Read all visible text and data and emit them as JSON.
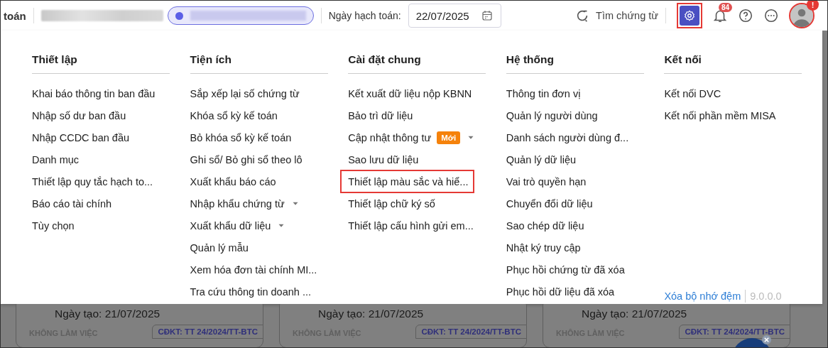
{
  "header": {
    "title": "toán",
    "date_label": "Ngày hạch toán:",
    "date_value": "22/07/2025",
    "search_label": "Tìm chứng từ",
    "settings_highlighted": true,
    "notification_count": "84",
    "avatar_alert": "!"
  },
  "menu": {
    "columns": [
      {
        "title": "Thiết lập",
        "items": [
          {
            "label": "Khai báo thông tin ban đầu"
          },
          {
            "label": "Nhập số dư ban đầu"
          },
          {
            "label": "Nhập CCDC ban đầu"
          },
          {
            "label": "Danh mục"
          },
          {
            "label": "Thiết lập quy tắc hạch to..."
          },
          {
            "label": "Báo cáo tài chính"
          },
          {
            "label": "Tùy chọn"
          }
        ]
      },
      {
        "title": "Tiện ích",
        "items": [
          {
            "label": "Sắp xếp lại số chứng từ"
          },
          {
            "label": "Khóa sổ kỳ kế toán"
          },
          {
            "label": "Bỏ khóa sổ kỳ kế toán"
          },
          {
            "label": "Ghi sổ/ Bỏ ghi sổ theo lô"
          },
          {
            "label": "Xuất khẩu báo cáo"
          },
          {
            "label": "Nhập khẩu chứng từ",
            "has_submenu": true
          },
          {
            "label": "Xuất khẩu dữ liệu",
            "has_submenu": true
          },
          {
            "label": "Quản lý mẫu"
          },
          {
            "label": "Xem hóa đơn tài chính MI..."
          },
          {
            "label": "Tra cứu thông tin doanh ..."
          }
        ]
      },
      {
        "title": "Cài đặt chung",
        "items": [
          {
            "label": "Kết xuất dữ liệu nộp KBNN"
          },
          {
            "label": "Bảo trì dữ liệu"
          },
          {
            "label": "Cập nhật thông tư",
            "badge": "Mới",
            "has_submenu": true
          },
          {
            "label": "Sao lưu dữ liệu"
          },
          {
            "label": "Thiết lập màu sắc và hiể...",
            "highlighted": true
          },
          {
            "label": "Thiết lập chữ ký số"
          },
          {
            "label": "Thiết lập cấu hình gửi em..."
          }
        ]
      },
      {
        "title": "Hệ thống",
        "items": [
          {
            "label": "Thông tin đơn vị"
          },
          {
            "label": "Quản lý người dùng"
          },
          {
            "label": "Danh sách người dùng đ..."
          },
          {
            "label": "Quản lý dữ liệu"
          },
          {
            "label": "Vai trò quyền hạn"
          },
          {
            "label": "Chuyển đổi dữ liệu"
          },
          {
            "label": "Sao chép dữ liệu"
          },
          {
            "label": "Nhật ký truy cập"
          },
          {
            "label": "Phục hồi chứng từ đã xóa"
          },
          {
            "label": "Phục hồi dữ liệu đã xóa"
          }
        ]
      },
      {
        "title": "Kết nối",
        "items": [
          {
            "label": "Kết nối DVC"
          },
          {
            "label": "Kết nối phần mềm MISA"
          }
        ]
      }
    ],
    "clear_cache": "Xóa bộ nhớ đệm",
    "version": "9.0.0.0"
  },
  "cards": [
    {
      "created": "Ngày tạo: 21/07/2025",
      "status": "KHÔNG LÀM VIỆC",
      "regime": "CĐKT: TT 24/2024/TT-BTC"
    },
    {
      "created": "Ngày tạo: 21/07/2025",
      "status": "KHÔNG LÀM VIỆC",
      "regime": "CĐKT: TT 24/2024/TT-BTC"
    },
    {
      "created": "Ngày tạo: 21/07/2025",
      "status": "KHÔNG LÀM VIỆC",
      "regime": "CĐKT: TT 24/2024/TT-BTC"
    }
  ]
}
